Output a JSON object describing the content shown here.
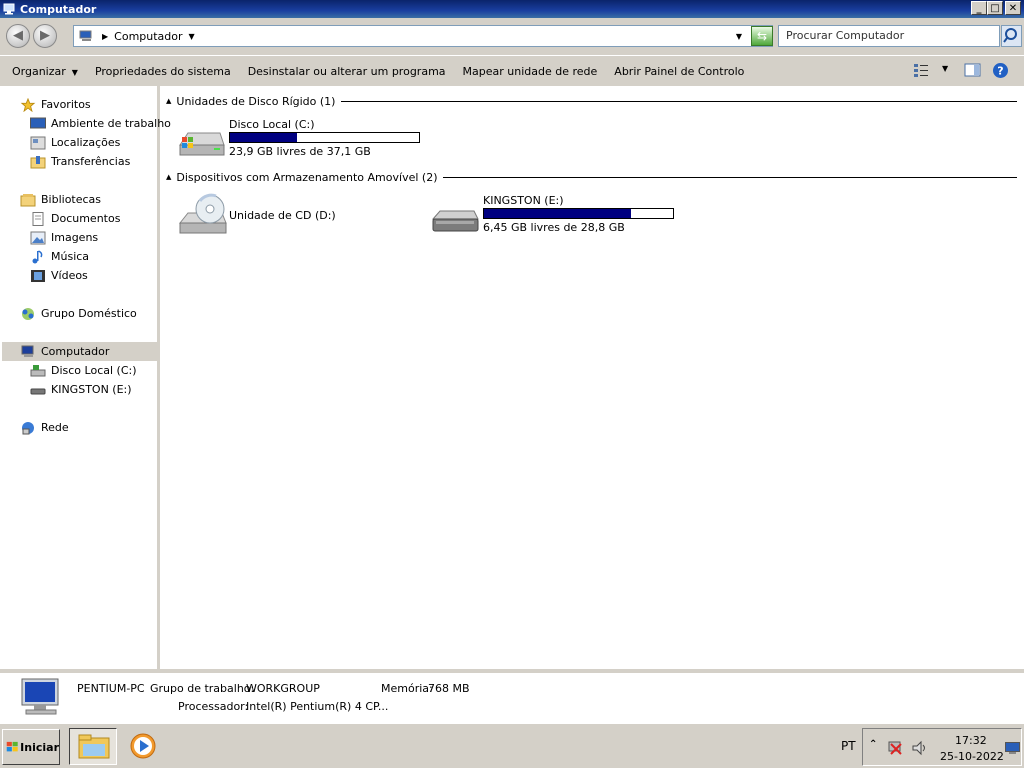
{
  "window": {
    "title": "Computador"
  },
  "caption_buttons": {
    "minimize": "_",
    "maximize": "□",
    "close": "✕"
  },
  "address": {
    "crumb": "Computador",
    "search_placeholder": "Procurar Computador"
  },
  "commands": [
    "Organizar",
    "Propriedades do sistema",
    "Desinstalar ou alterar um programa",
    "Mapear unidade de rede",
    "Abrir Painel de Controlo"
  ],
  "nav": {
    "favorites": "Favoritos",
    "fav_items": [
      "Ambiente de trabalho",
      "Localizações",
      "Transferências"
    ],
    "libraries": "Bibliotecas",
    "lib_items": [
      "Documentos",
      "Imagens",
      "Música",
      "Vídeos"
    ],
    "homegroup": "Grupo Doméstico",
    "computer": "Computador",
    "comp_items": [
      "Disco Local (C:)",
      "KINGSTON (E:)"
    ],
    "network": "Rede"
  },
  "groups": {
    "hdd": "Unidades de Disco Rígido (1)",
    "removable": "Dispositivos com Armazenamento Amovível (2)"
  },
  "drives": {
    "c": {
      "name": "Disco Local (C:)",
      "free": "23,9 GB livres de 37,1 GB",
      "used_fraction": 0.356
    },
    "d": {
      "name": "Unidade de CD (D:)"
    },
    "e": {
      "name": "KINGSTON (E:)",
      "free": "6,45 GB livres de 28,8 GB",
      "used_fraction": 0.776
    }
  },
  "details": {
    "pc_name": "PENTIUM-PC",
    "workgroup_label": "Grupo de trabalho:",
    "workgroup_value": "WORKGROUP",
    "memory_label": "Memória:",
    "memory_value": "768 MB",
    "processor_label": "Processador:",
    "processor_value": "Intel(R) Pentium(R) 4 CP..."
  },
  "taskbar": {
    "start_label": "Iniciar",
    "language": "PT",
    "time": "17:32",
    "date": "25-10-2022"
  },
  "colors": {
    "usage_bar": "#000080",
    "chrome": "#d4d0c8",
    "titlebar": "#0a246a"
  }
}
